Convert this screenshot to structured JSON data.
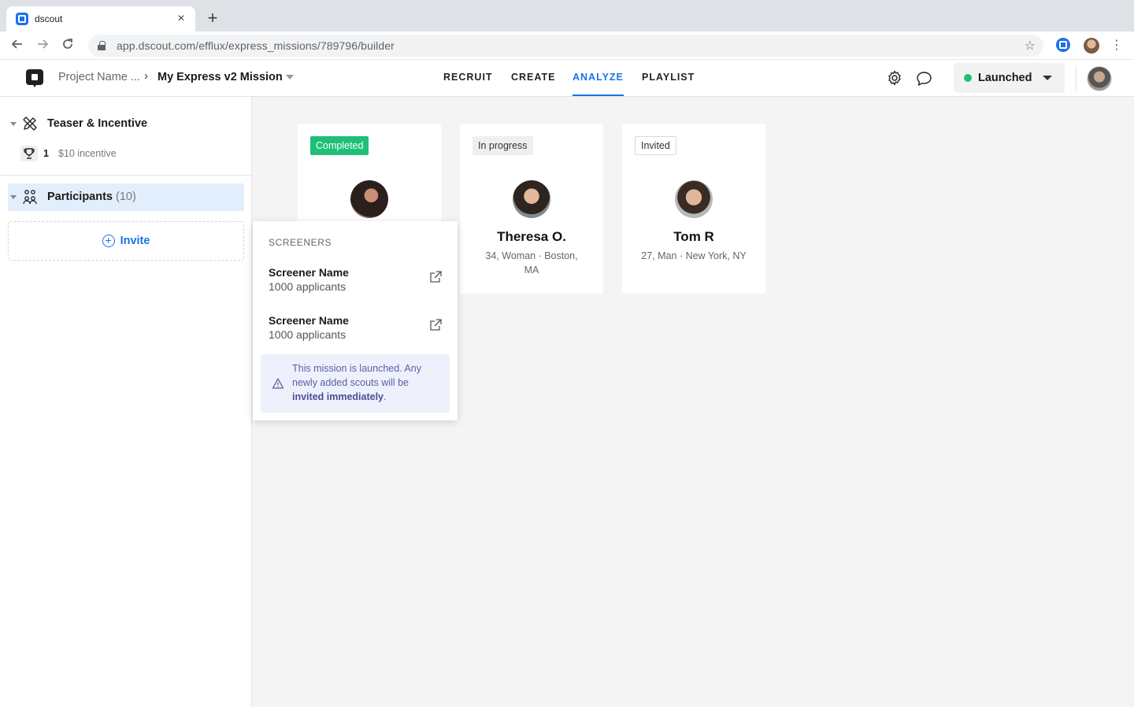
{
  "browser": {
    "tab_title": "dscout",
    "tab_close": "×",
    "new_tab": "+",
    "url": "app.dscout.com/efflux/express_missions/789796/builder"
  },
  "header": {
    "breadcrumb_project": "Project Name ...",
    "breadcrumb_separator": "›",
    "breadcrumb_mission": "My Express v2 Mission",
    "nav_tabs": [
      "RECRUIT",
      "CREATE",
      "ANALYZE",
      "PLAYLIST"
    ],
    "active_tab": "ANALYZE",
    "status_label": "Launched",
    "status_color": "#1fbf78",
    "accent_color": "#1a73e8"
  },
  "sidebar": {
    "teaser_title": "Teaser & Incentive",
    "incentive_count": "1",
    "incentive_text": "$10 incentive",
    "participants_label": "Participants",
    "participants_count": "(10)",
    "invite_label": "Invite"
  },
  "participants": [
    {
      "status": "Completed",
      "name": "",
      "detail": ""
    },
    {
      "status": "In progress",
      "name": "Theresa O.",
      "detail": "34, Woman · Boston, MA"
    },
    {
      "status": "Invited",
      "name": "Tom R",
      "detail": "27, Man · New York, NY"
    }
  ],
  "screeners_popover": {
    "heading": "SCREENERS",
    "items": [
      {
        "name": "Screener Name",
        "count": "1000 applicants"
      },
      {
        "name": "Screener Name",
        "count": "1000 applicants"
      }
    ],
    "notice_text": "This mission is launched. Any newly added scouts will be ",
    "notice_bold": "invited immediately",
    "notice_end": "."
  }
}
